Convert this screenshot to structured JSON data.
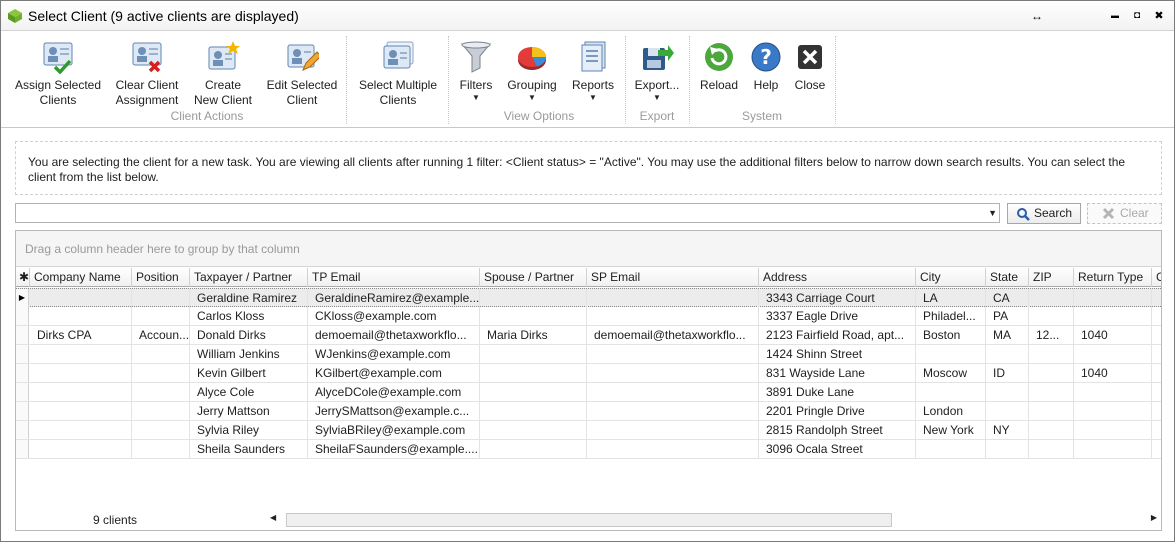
{
  "window": {
    "title": "Select Client (9 active clients are displayed)",
    "controls": {
      "restore": "↔",
      "minimize": "▬",
      "maximize": "◘",
      "close": "✖"
    }
  },
  "ribbon": {
    "buttons": {
      "assign": "Assign Selected\nClients",
      "clear_assign": "Clear Client\nAssignment",
      "create": "Create\nNew Client",
      "edit": "Edit Selected\nClient",
      "select_multiple": "Select Multiple\nClients",
      "filters": "Filters",
      "grouping": "Grouping",
      "reports": "Reports",
      "export": "Export...",
      "reload": "Reload",
      "help": "Help",
      "close": "Close"
    },
    "groups": {
      "client_actions": "Client Actions",
      "view_options": "View Options",
      "export": "Export",
      "system": "System"
    },
    "icons": {
      "assign": "assign-client-icon",
      "clear_assign": "clear-assignment-icon",
      "create": "create-client-icon",
      "edit": "edit-client-icon",
      "select_multiple": "select-multiple-icon",
      "filters": "funnel-icon",
      "grouping": "pie-chart-icon",
      "reports": "reports-icon",
      "export": "export-icon",
      "reload": "reload-icon",
      "help": "help-icon",
      "close": "close-icon"
    }
  },
  "info": {
    "text": "You are selecting the client for a new task. You are viewing all clients after running 1 filter: <Client status> = \"Active\". You may use the additional filters below to narrow down search results. You can select the client from the list below."
  },
  "search": {
    "value": "",
    "search_label": "Search",
    "clear_label": "Clear"
  },
  "grid": {
    "group_panel_text": "Drag a column header here to group by that column",
    "indicator_header": "✱",
    "columns": [
      "Company Name",
      "Position",
      "Taxpayer / Partner",
      "TP Email",
      "Spouse / Partner",
      "SP Email",
      "Address",
      "City",
      "State",
      "ZIP",
      "Return Type",
      "C"
    ],
    "rows": [
      [
        "",
        "",
        "Geraldine Ramirez",
        "GeraldineRamirez@example...",
        "",
        "",
        "3343 Carriage Court",
        "LA",
        "CA",
        "",
        "",
        ""
      ],
      [
        "",
        "",
        "Carlos Kloss",
        "CKloss@example.com",
        "",
        "",
        "3337 Eagle Drive",
        "Philadel...",
        "PA",
        "",
        "",
        ""
      ],
      [
        "Dirks CPA",
        "Accoun...",
        "Donald Dirks",
        "demoemail@thetaxworkflo...",
        "Maria Dirks",
        "demoemail@thetaxworkflo...",
        "2123 Fairfield Road, apt...",
        "Boston",
        "MA",
        "12...",
        "1040",
        ""
      ],
      [
        "",
        "",
        "William Jenkins",
        "WJenkins@example.com",
        "",
        "",
        "1424 Shinn Street",
        "",
        "",
        "",
        "",
        ""
      ],
      [
        "",
        "",
        "Kevin Gilbert",
        "KGilbert@example.com",
        "",
        "",
        "831 Wayside Lane",
        "Moscow",
        "ID",
        "",
        "1040",
        ""
      ],
      [
        "",
        "",
        "Alyce Cole",
        "AlyceDCole@example.com",
        "",
        "",
        "3891 Duke Lane",
        "",
        "",
        "",
        "",
        ""
      ],
      [
        "",
        "",
        "Jerry Mattson",
        "JerrySMattson@example.c...",
        "",
        "",
        "2201 Pringle Drive",
        "London",
        "",
        "",
        "",
        ""
      ],
      [
        "",
        "",
        "Sylvia Riley",
        "SylviaBRiley@example.com",
        "",
        "",
        "2815 Randolph Street",
        "New York",
        "NY",
        "",
        "",
        ""
      ],
      [
        "",
        "",
        "Sheila Saunders",
        "SheilaFSaunders@example....",
        "",
        "",
        "3096 Ocala Street",
        "",
        "",
        "",
        "",
        ""
      ]
    ],
    "selected_row_indicator": "▶",
    "footer_count": "9 clients"
  }
}
